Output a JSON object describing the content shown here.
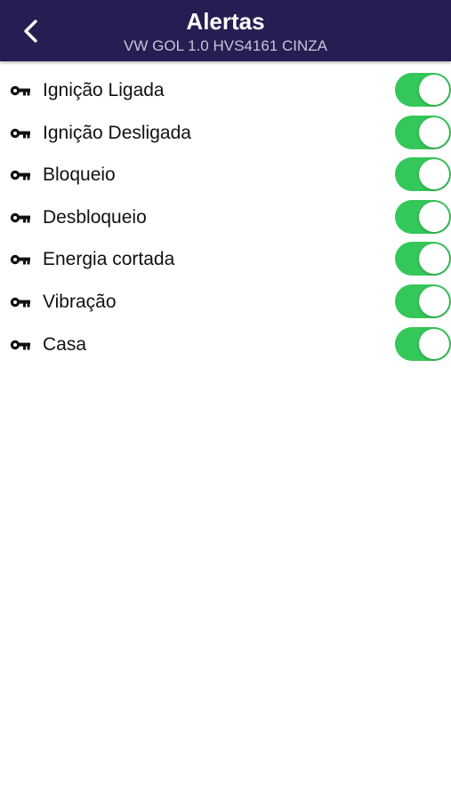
{
  "header": {
    "title": "Alertas",
    "subtitle": "VW GOL 1.0 HVS4161 CINZA",
    "background_color": "#261d52",
    "back_icon": "chevron-left-icon"
  },
  "alerts": {
    "toggle_on_color": "#34c759",
    "row_icon": "key-icon",
    "items": [
      {
        "label": "Ignição Ligada",
        "enabled": true
      },
      {
        "label": "Ignição Desligada",
        "enabled": true
      },
      {
        "label": "Bloqueio",
        "enabled": true
      },
      {
        "label": "Desbloqueio",
        "enabled": true
      },
      {
        "label": "Energia cortada",
        "enabled": true
      },
      {
        "label": "Vibração",
        "enabled": true
      },
      {
        "label": "Casa",
        "enabled": true
      }
    ]
  }
}
